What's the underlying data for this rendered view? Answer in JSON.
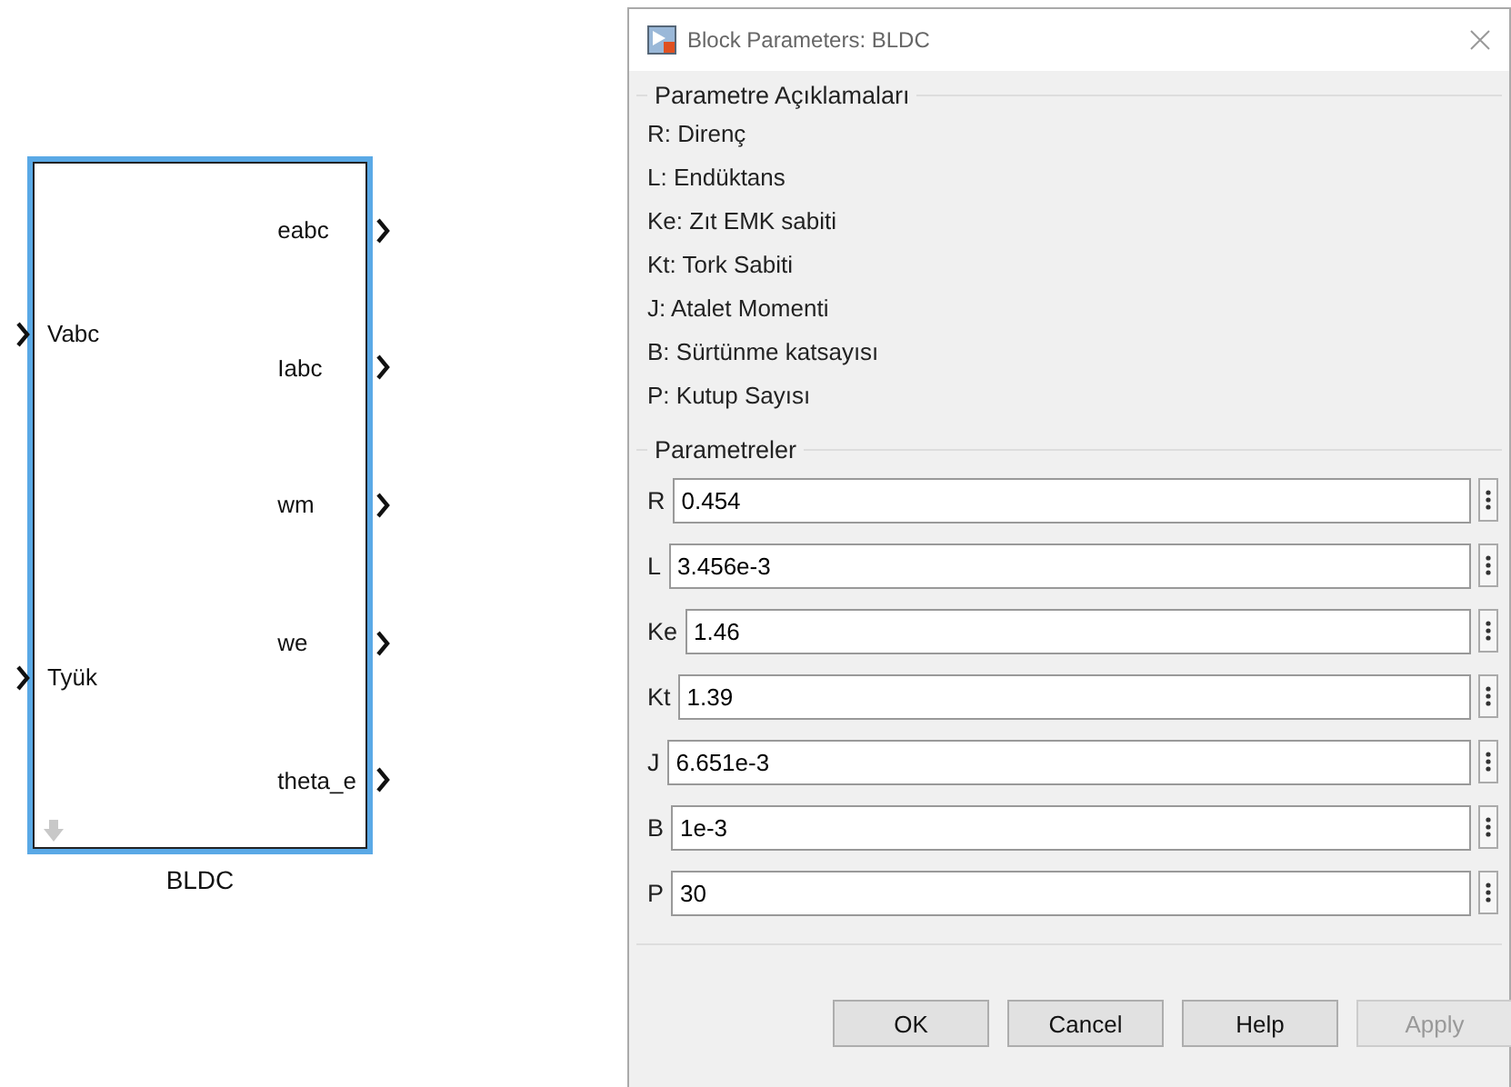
{
  "block": {
    "name": "BLDC",
    "inputs": [
      "Vabc",
      "Tyük"
    ],
    "outputs": [
      "eabc",
      "Iabc",
      "wm",
      "we",
      "theta_e"
    ],
    "selected": true
  },
  "dialog": {
    "title": "Block Parameters: BLDC",
    "description": {
      "title": "Parametre Açıklamaları",
      "lines": [
        "R: Direnç",
        "L: Endüktans",
        "Ke: Zıt EMK sabiti",
        "Kt: Tork Sabiti",
        "J: Atalet Momenti",
        "B: Sürtünme katsayısı",
        "P: Kutup Sayısı"
      ]
    },
    "parameters": {
      "title": "Parametreler",
      "fields": [
        {
          "label": "R",
          "value": "0.454"
        },
        {
          "label": "L",
          "value": "3.456e-3"
        },
        {
          "label": "Ke",
          "value": "1.46"
        },
        {
          "label": "Kt",
          "value": "1.39"
        },
        {
          "label": "J",
          "value": "6.651e-3"
        },
        {
          "label": "B",
          "value": "1e-3"
        },
        {
          "label": "P",
          "value": "30"
        }
      ]
    },
    "buttons": [
      {
        "label": "OK",
        "disabled": false
      },
      {
        "label": "Cancel",
        "disabled": false
      },
      {
        "label": "Help",
        "disabled": false
      },
      {
        "label": "Apply",
        "disabled": true
      }
    ]
  }
}
